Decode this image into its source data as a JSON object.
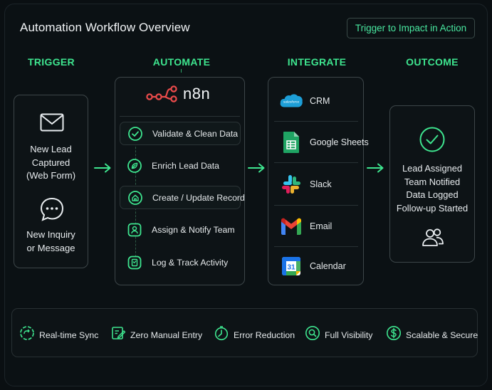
{
  "header": {
    "title": "Automation Workflow Overview",
    "badge": "Trigger to Impact in Action"
  },
  "columns": {
    "trigger": "TRIGGER",
    "automate": "AUTOMATE",
    "integrate": "INTEGRATE",
    "outcome": "OUTCOME"
  },
  "trigger": {
    "item1": [
      "New Lead",
      "Captured",
      "(Web Form)"
    ],
    "item2": [
      "New Inquiry",
      "or Message"
    ]
  },
  "automate": {
    "brand": "n8n",
    "steps": [
      {
        "label": "Validate & Clean Data",
        "icon": "check-circle-icon"
      },
      {
        "label": "Enrich Lead Data",
        "icon": "leaf-icon"
      },
      {
        "label": "Create / Update Record",
        "icon": "home-icon"
      },
      {
        "label": "Assign & Notify Team",
        "icon": "user-icon"
      },
      {
        "label": "Log & Track Activity",
        "icon": "log-icon"
      }
    ]
  },
  "integrate": {
    "items": [
      {
        "label": "CRM",
        "icon": "salesforce-icon",
        "logo_text": "salesforce"
      },
      {
        "label": "Google Sheets",
        "icon": "google-sheets-icon"
      },
      {
        "label": "Slack",
        "icon": "slack-icon"
      },
      {
        "label": "Email",
        "icon": "gmail-icon"
      },
      {
        "label": "Calendar",
        "icon": "google-calendar-icon",
        "logo_text": "31"
      }
    ]
  },
  "outcome": {
    "lines": [
      "Lead Assigned",
      "Team Notified",
      "Data Logged",
      "Follow-up Started"
    ]
  },
  "features": [
    {
      "label": "Real-time Sync",
      "icon": "sync-icon"
    },
    {
      "label": "Zero Manual Entry",
      "icon": "edit-icon"
    },
    {
      "label": "Error Reduction",
      "icon": "clock-icon"
    },
    {
      "label": "Full Visibility",
      "icon": "magnifier-icon"
    },
    {
      "label": "Scalable & Secure",
      "icon": "dollar-icon"
    }
  ],
  "colors": {
    "accent": "#3ee58f",
    "background": "#0a0f12",
    "card_border": "#3d4649"
  }
}
